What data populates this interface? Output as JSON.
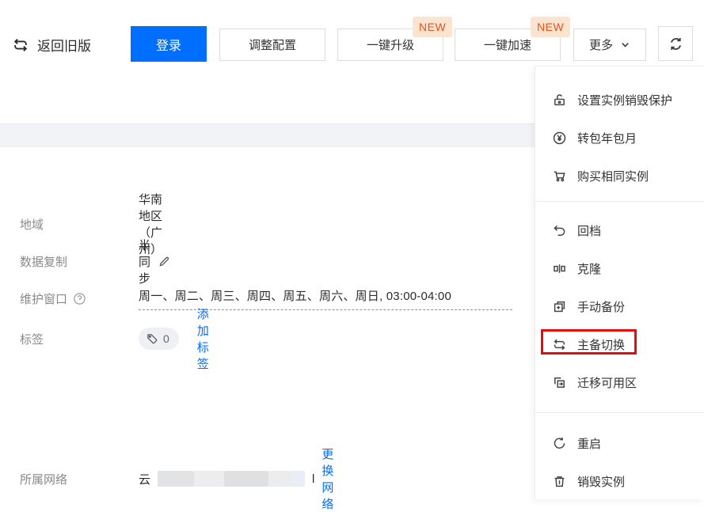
{
  "toolbar": {
    "back": "返回旧版",
    "login": "登录",
    "adjust": "调整配置",
    "upgrade": "一键升级",
    "accelerate": "一键加速",
    "more": "更多",
    "new_badge": "NEW"
  },
  "info": {
    "region_label": "地域",
    "region_value": "华南地区（广州）",
    "replication_label": "数据复制",
    "replication_value": "半同步",
    "maintenance_label": "维护窗口",
    "maintenance_value": "周一、周二、周三、周四、周五、周六、周日, 03:00-04:00",
    "tags_label": "标签",
    "tags_count": "0",
    "tags_add_link": "添加标签",
    "network_label": "所属网络",
    "network_prefix": "云",
    "network_suffix": "l",
    "network_change_link": "更换网络"
  },
  "menu": {
    "items": [
      {
        "label": "设置实例销毁保护",
        "icon": "unlock-icon"
      },
      {
        "label": "转包年包月",
        "icon": "yen-circle-icon"
      },
      {
        "label": "购买相同实例",
        "icon": "cart-icon"
      },
      {
        "label": "回档",
        "icon": "rollback-icon"
      },
      {
        "label": "克隆",
        "icon": "clone-icon"
      },
      {
        "label": "手动备份",
        "icon": "backup-icon"
      },
      {
        "label": "主备切换",
        "icon": "swap-icon",
        "highlighted": true
      },
      {
        "label": "迁移可用区",
        "icon": "migrate-icon"
      },
      {
        "label": "重启",
        "icon": "restart-icon"
      },
      {
        "label": "销毁实例",
        "icon": "trash-icon"
      }
    ]
  },
  "colors": {
    "primary_blue": "#006eff",
    "link_blue": "#006eff",
    "new_badge_bg": "#fce4d1",
    "new_badge_text": "#e8531d",
    "highlight_red": "#e60c0c",
    "band_gray": "#f2f3f6"
  }
}
